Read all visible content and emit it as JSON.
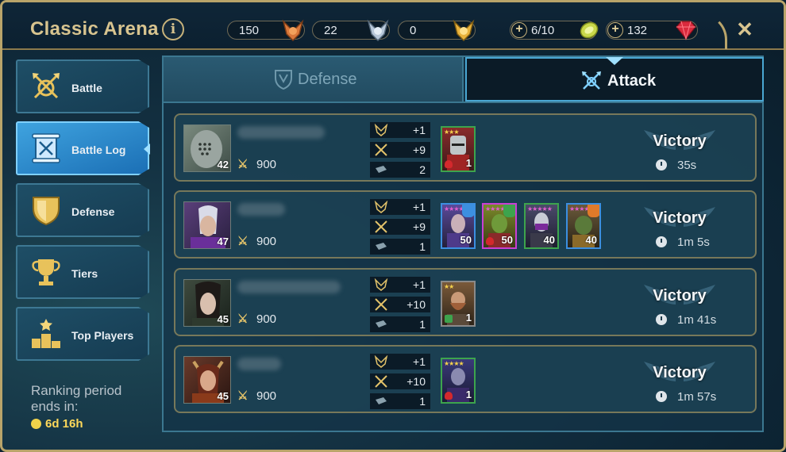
{
  "header": {
    "title": "Classic Arena",
    "resources": [
      {
        "name": "bronze-medals",
        "value": "150",
        "color": "#d9773a"
      },
      {
        "name": "silver-medals",
        "value": "22",
        "color": "#b7c7d8"
      },
      {
        "name": "gold-medals",
        "value": "0",
        "color": "#e9b23b"
      },
      {
        "name": "arena-tokens",
        "value": "6/10",
        "color": "#c9d84a"
      },
      {
        "name": "gems",
        "value": "132",
        "color": "#d92a3d"
      }
    ]
  },
  "sidebar": {
    "items": [
      {
        "label": "Battle",
        "icon": "crossed-axes-icon",
        "active": false
      },
      {
        "label": "Battle Log",
        "icon": "scroll-icon",
        "active": true
      },
      {
        "label": "Defense",
        "icon": "shield-icon",
        "active": false
      },
      {
        "label": "Tiers",
        "icon": "trophy-icon",
        "active": false
      },
      {
        "label": "Top Players",
        "icon": "podium-icon",
        "active": false
      }
    ],
    "ranking_label": "Ranking period ends in:",
    "ranking_time": "6d 16h"
  },
  "tabs": {
    "defense": "Defense",
    "attack": "Attack"
  },
  "log": [
    {
      "level": "42",
      "power": "900",
      "stats": {
        "medals": "+1",
        "rating": "+9",
        "tokens": "2"
      },
      "heroes": [
        {
          "level": "1",
          "stars": "★★★",
          "border": "#3da44d"
        }
      ],
      "result": "Victory",
      "time": "35s"
    },
    {
      "level": "47",
      "power": "900",
      "stats": {
        "medals": "+1",
        "rating": "+9",
        "tokens": "1"
      },
      "heroes": [
        {
          "level": "50",
          "stars": "★★★★★★",
          "border": "#3c8fe0"
        },
        {
          "level": "50",
          "stars": "★★★★★★",
          "border": "#c93fd4"
        },
        {
          "level": "40",
          "stars": "★★★★★",
          "border": "#3da44d"
        },
        {
          "level": "40",
          "stars": "★★★★★",
          "border": "#3c8fe0"
        }
      ],
      "result": "Victory",
      "time": "1m 5s"
    },
    {
      "level": "45",
      "power": "900",
      "stats": {
        "medals": "+1",
        "rating": "+10",
        "tokens": "1"
      },
      "heroes": [
        {
          "level": "1",
          "stars": "★★",
          "border": "#8a8a8a"
        }
      ],
      "result": "Victory",
      "time": "1m 41s"
    },
    {
      "level": "45",
      "power": "900",
      "stats": {
        "medals": "+1",
        "rating": "+10",
        "tokens": "1"
      },
      "heroes": [
        {
          "level": "1",
          "stars": "★★★★",
          "border": "#3da44d"
        }
      ],
      "result": "Victory",
      "time": "1m 57s"
    }
  ]
}
